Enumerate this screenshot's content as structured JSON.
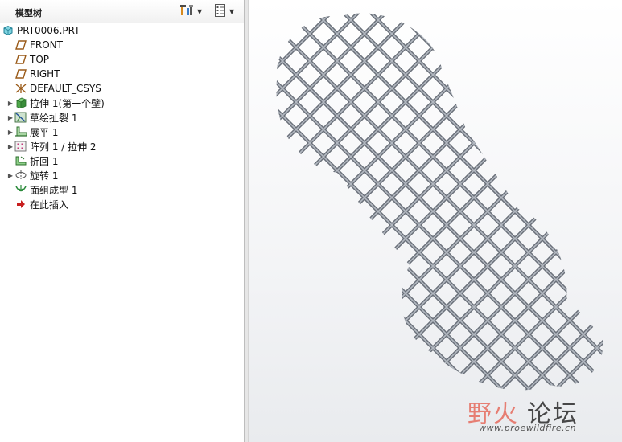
{
  "panel": {
    "title": "模型树",
    "settings_icon": "tools-icon",
    "show_icon": "list-settings-icon"
  },
  "tree": {
    "root": "PRT0006.PRT",
    "items": [
      {
        "label": "FRONT",
        "icon": "datum-plane-icon",
        "expandable": false
      },
      {
        "label": "TOP",
        "icon": "datum-plane-icon",
        "expandable": false
      },
      {
        "label": "RIGHT",
        "icon": "datum-plane-icon",
        "expandable": false
      },
      {
        "label": "DEFAULT_CSYS",
        "icon": "csys-icon",
        "expandable": false
      },
      {
        "label": "拉伸 1(第一个壁)",
        "icon": "extrude-wall-icon",
        "expandable": true
      },
      {
        "label": "草绘扯裂 1",
        "icon": "sketch-rip-icon",
        "expandable": true
      },
      {
        "label": "展平 1",
        "icon": "unbend-icon",
        "expandable": true
      },
      {
        "label": "阵列 1 / 拉伸 2",
        "icon": "pattern-icon",
        "expandable": true
      },
      {
        "label": "折回 1",
        "icon": "bend-back-icon",
        "expandable": false
      },
      {
        "label": "旋转 1",
        "icon": "revolve-icon",
        "expandable": true
      },
      {
        "label": "面组成型 1",
        "icon": "quilt-form-icon",
        "expandable": false
      },
      {
        "label": "在此插入",
        "icon": "insert-here-arrow-icon",
        "expandable": false
      }
    ]
  },
  "watermark": {
    "cn_red": "野火",
    "cn_dark": "论坛",
    "url": "www.proewildfire.cn"
  }
}
